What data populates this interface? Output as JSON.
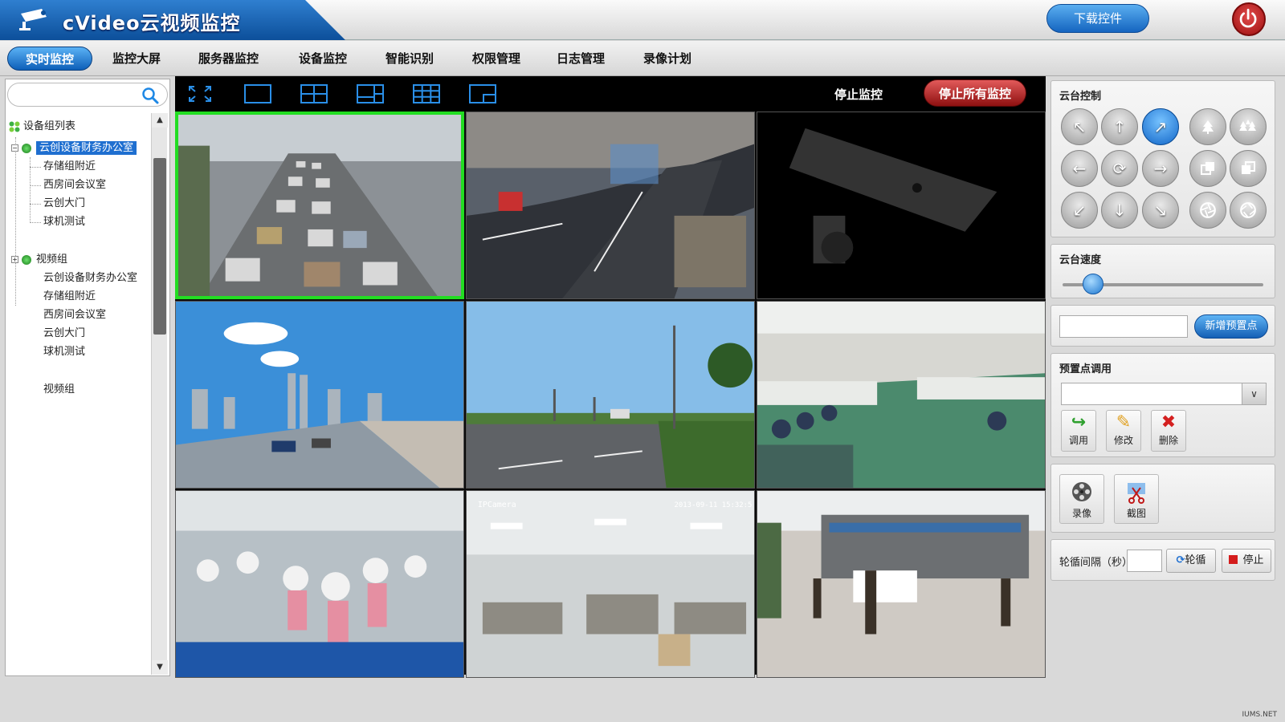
{
  "app": {
    "title": "cVideo云视频监控",
    "download_label": "下载控件"
  },
  "nav": {
    "items": [
      {
        "label": "实时监控",
        "active": true
      },
      {
        "label": "监控大屏"
      },
      {
        "label": "服务器监控"
      },
      {
        "label": "设备监控"
      },
      {
        "label": "智能识别"
      },
      {
        "label": "权限管理"
      },
      {
        "label": "日志管理"
      },
      {
        "label": "录像计划"
      }
    ]
  },
  "sidebar": {
    "search_placeholder": "",
    "root_label": "设备组列表",
    "groups": [
      {
        "label": "云创设备财务办公室",
        "selected": true,
        "children": [
          "存储组附近",
          "西房间会议室",
          "云创大门",
          "球机测试"
        ]
      },
      {
        "label": "视频组",
        "children": [
          "云创设备财务办公室",
          "存储组附近",
          "西房间会议室",
          "云创大门",
          "球机测试"
        ]
      },
      {
        "label": "视频组",
        "children": []
      }
    ]
  },
  "video": {
    "stop_label": "停止监控",
    "stop_all_label": "停止所有监控",
    "layouts": [
      "fullscreen-icon",
      "layout-1-icon",
      "layout-4-icon",
      "layout-6-icon",
      "layout-9-icon",
      "layout-pip-icon"
    ],
    "cells": [
      {
        "name": "highway-traffic",
        "selected": true
      },
      {
        "name": "city-intersection"
      },
      {
        "name": "no-signal-camera"
      },
      {
        "name": "city-bridge"
      },
      {
        "name": "road-with-lamps"
      },
      {
        "name": "factory-floor"
      },
      {
        "name": "assembly-workers"
      },
      {
        "name": "office-room",
        "overlay_left": "IPCamera",
        "overlay_right": "2013-09-11 15:32:5"
      },
      {
        "name": "courtyard-people"
      }
    ]
  },
  "ptz": {
    "title": "云台控制",
    "buttons": [
      "arrow-up-left",
      "arrow-up",
      "arrow-up-right",
      "zoom-in-tree",
      "zoom-out-trees",
      "arrow-left",
      "auto-rotate",
      "arrow-right",
      "focus-near",
      "focus-far",
      "arrow-down-left",
      "arrow-down",
      "arrow-down-right",
      "iris-open",
      "iris-close"
    ],
    "active": "arrow-up-right"
  },
  "speed": {
    "title": "云台速度",
    "level": 0.15
  },
  "preset_add": {
    "value": "",
    "button_label": "新增预置点"
  },
  "preset_call": {
    "title": "预置点调用",
    "selected": "",
    "call_label": "调用",
    "edit_label": "修改",
    "delete_label": "删除"
  },
  "record": {
    "record_label": "录像",
    "snapshot_label": "截图"
  },
  "patrol": {
    "interval_label": "轮循间隔（秒）",
    "interval_value": "",
    "start_label": "轮循",
    "stop_label": "停止"
  },
  "watermark": "IUMS.NET",
  "colors": {
    "brand_blue": "#1565c0",
    "selected_green": "#22dd22",
    "stop_red": "#c62828"
  }
}
